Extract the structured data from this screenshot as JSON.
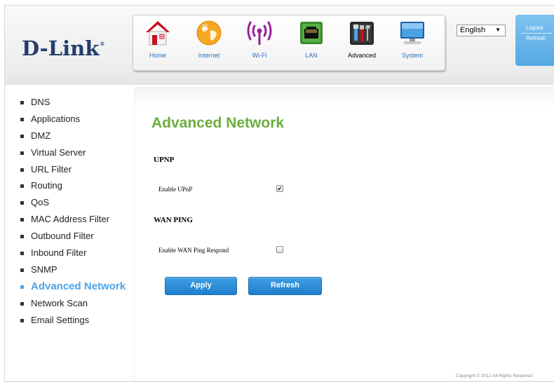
{
  "brand": {
    "logo": "D-Link",
    "registered_mark": "®"
  },
  "nav": [
    {
      "label": "Home",
      "icon": "home-icon",
      "active": false
    },
    {
      "label": "Internet",
      "icon": "globe-icon",
      "active": false
    },
    {
      "label": "Wi-Fi",
      "icon": "wifi-icon",
      "active": false
    },
    {
      "label": "LAN",
      "icon": "lan-port-icon",
      "active": false
    },
    {
      "label": "Advanced",
      "icon": "tools-icon",
      "active": true
    },
    {
      "label": "System",
      "icon": "monitor-icon",
      "active": false
    }
  ],
  "language": {
    "selected": "English",
    "arrow": "▼"
  },
  "user_links": {
    "logout": "Logout",
    "refresh": "Refresh"
  },
  "sidebar": {
    "items": [
      {
        "label": "DNS",
        "active": false
      },
      {
        "label": "Applications",
        "active": false
      },
      {
        "label": "DMZ",
        "active": false
      },
      {
        "label": "Virtual Server",
        "active": false
      },
      {
        "label": "URL Filter",
        "active": false
      },
      {
        "label": "Routing",
        "active": false
      },
      {
        "label": "QoS",
        "active": false
      },
      {
        "label": "MAC Address Filter",
        "active": false
      },
      {
        "label": "Outbound Filter",
        "active": false
      },
      {
        "label": "Inbound Filter",
        "active": false
      },
      {
        "label": "SNMP",
        "active": false
      },
      {
        "label": "Advanced Network",
        "active": true
      },
      {
        "label": "Network Scan",
        "active": false
      },
      {
        "label": "Email Settings",
        "active": false
      }
    ]
  },
  "page": {
    "title": "Advanced Network",
    "upnp": {
      "section": "UPNP",
      "label": "Enable UPnP",
      "checked": true
    },
    "wan_ping": {
      "section": "WAN PING",
      "label": "Enable WAN Ping Respond",
      "checked": false
    }
  },
  "buttons": {
    "apply": "Apply",
    "refresh": "Refresh"
  },
  "footer": {
    "copyright": "Copyright © 2012  All Rights Reserved"
  },
  "colors": {
    "accent_blue": "#2a86d6",
    "title_green": "#6aae3d",
    "active_menu": "#4da4e8",
    "logo_navy": "#243f6d"
  }
}
